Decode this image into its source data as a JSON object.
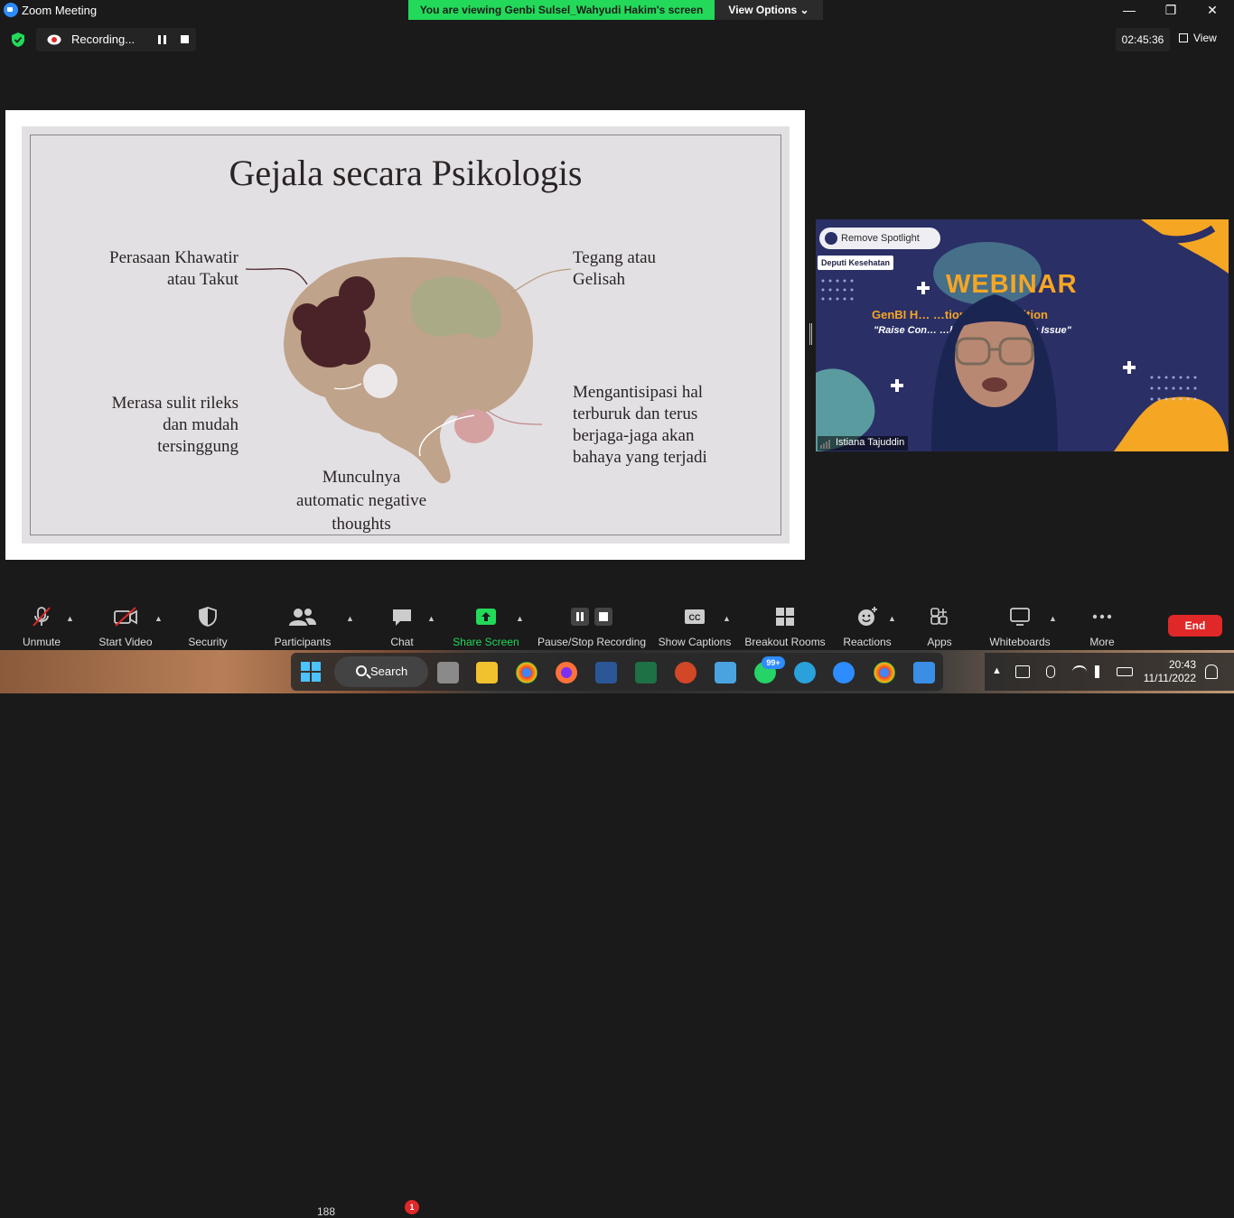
{
  "window": {
    "title": "Zoom Meeting",
    "viewing_banner": "You are viewing Genbi Sulsel_Wahyudi Hakim's screen",
    "view_options": "View Options",
    "minimize": "—",
    "maximize": "❐",
    "close": "✕"
  },
  "recording": {
    "label": "Recording..."
  },
  "timer": "02:45:36",
  "view_label": "View",
  "slide": {
    "title": "Gejala secara Psikologis",
    "items": [
      "Perasaan Khawatir\natau Takut",
      "Tegang atau\nGelisah",
      "Merasa sulit rileks\ndan mudah\ntersinggung",
      "Mengantisipasi hal\nterburuk dan terus\nberjaga-jaga akan\nbahaya yang terjadi",
      "Munculnya\nautomatic negative\nthoughts"
    ]
  },
  "video": {
    "spotlight_label": "Remove Spotlight",
    "deputi": "Deputi Kesehatan",
    "webinar": "WEBINAR",
    "competition": "GenBI H… …tional Competition",
    "raise": "\"Raise Con… …bout Mental Health Issue\"",
    "participant_name": "Istiana Tajuddin"
  },
  "toolbar": {
    "unmute": "Unmute",
    "start_video": "Start Video",
    "security": "Security",
    "participants": "Participants",
    "participants_count": "188",
    "chat": "Chat",
    "chat_badge": "1",
    "share_screen": "Share Screen",
    "pause_stop_recording": "Pause/Stop Recording",
    "show_captions": "Show Captions",
    "breakout_rooms": "Breakout Rooms",
    "reactions": "Reactions",
    "apps": "Apps",
    "whiteboards": "Whiteboards",
    "more": "More",
    "end": "End"
  },
  "taskbar": {
    "search": "Search",
    "whatsapp_badge": "99+",
    "time": "20:43",
    "date": "11/11/2022"
  },
  "colors": {
    "zoom_green": "#23d959",
    "end_red": "#e02828",
    "zoom_blue": "#2d8cff",
    "brain": "#bfa38a",
    "dark_lobe": "#4a2328"
  }
}
